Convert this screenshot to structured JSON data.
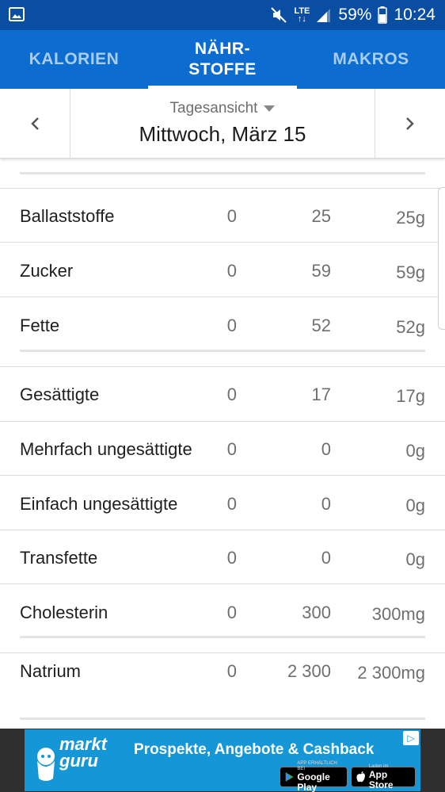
{
  "status_bar": {
    "network": "LTE",
    "battery_percent": "59%",
    "time": "10:24"
  },
  "tabs": [
    {
      "label": "KALORIEN",
      "active": false
    },
    {
      "label_line1": "NÄHR-",
      "label_line2": "STOFFE",
      "active": true
    },
    {
      "label": "MAKROS",
      "active": false
    }
  ],
  "date_nav": {
    "view_label": "Tagesansicht",
    "date": "Mittwoch, März 15"
  },
  "nutrients": [
    {
      "name": "Ballaststoffe",
      "total": "0",
      "goal": "25",
      "left": "25g"
    },
    {
      "name": "Zucker",
      "total": "0",
      "goal": "59",
      "left": "59g"
    },
    {
      "name": "Fette",
      "total": "0",
      "goal": "52",
      "left": "52g"
    },
    {
      "name": "Gesättigte",
      "total": "0",
      "goal": "17",
      "left": "17g"
    },
    {
      "name": "Mehrfach ungesättigte",
      "total": "0",
      "goal": "0",
      "left": "0g"
    },
    {
      "name": "Einfach ungesättigte",
      "total": "0",
      "goal": "0",
      "left": "0g"
    },
    {
      "name": "Transfette",
      "total": "0",
      "goal": "0",
      "left": "0g"
    },
    {
      "name": "Cholesterin",
      "total": "0",
      "goal": "300",
      "left": "300mg"
    },
    {
      "name": "Natrium",
      "total": "0",
      "goal": "2 300",
      "left": "2 300mg"
    }
  ],
  "ad": {
    "logo_line1": "markt",
    "logo_line2": "guru",
    "headline": "Prospekte, Angebote & Cashback",
    "google_small": "APP ERHÄLTLICH BEI",
    "google_big": "Google Play",
    "apple_small": "Laden im",
    "apple_big": "App Store"
  },
  "colors": {
    "status_bar": "#0a4ea3",
    "tab_bar": "#0d6ccf",
    "ad_background": "#1596d6"
  }
}
